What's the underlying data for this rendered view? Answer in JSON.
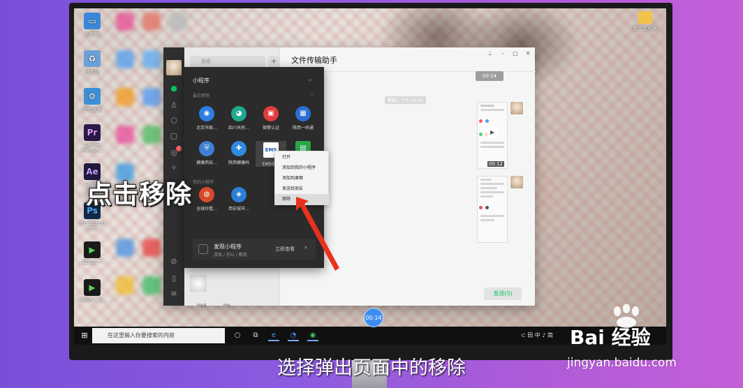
{
  "overlay": {
    "title": "点击移除",
    "subtitle": "选择弹出页面中的移除",
    "progress_time": "00:14"
  },
  "desktop": {
    "icons": [
      {
        "label": "此电脑",
        "icon": "computer-icon",
        "color": "#3b86d8"
      },
      {
        "label": "回收站",
        "icon": "recycle-bin-icon",
        "color": "#6aa0d8"
      },
      {
        "label": "控制面板",
        "icon": "control-panel-icon",
        "color": "#3c8fd6"
      },
      {
        "label": "Adobe Premie...",
        "icon": "premiere-icon",
        "color": "#2a1a4a"
      },
      {
        "label": "Adobe After Effects",
        "icon": "after-effects-icon",
        "color": "#1f1a3e"
      },
      {
        "label": "Photoshop CS6",
        "icon": "photoshop-icon",
        "color": "#0f2a4a"
      },
      {
        "label": "EDIUS 7",
        "icon": "edius-icon",
        "color": "#1a1a1a"
      },
      {
        "label": "EDIUS7_1...",
        "icon": "edius-icon",
        "color": "#1a1a1a"
      }
    ],
    "folder_label": "图片文件夹"
  },
  "wechat": {
    "window_title": "文件传输助手",
    "search_placeholder": "搜索",
    "plus": "+",
    "timestamp": "星期二 下午 02:43",
    "video_time_top": "00:14",
    "video_time_mid": "00:12",
    "send_label": "发送(S)",
    "contacts": [
      {
        "label": "mp4"
      },
      {
        "label": "mp"
      }
    ],
    "sidebar_badge": "7",
    "window_controls": {
      "pin": "⊥",
      "minimize": "–",
      "maximize": "□",
      "close": "✕"
    }
  },
  "mini_program": {
    "title": "小程序",
    "recent_label": "最近使用",
    "my_label": "我的小程序",
    "apps_row1": [
      {
        "label": "北京市政...",
        "color": "#2d7fe0",
        "icon": "app-icon"
      },
      {
        "label": "四川天府...",
        "color": "#1fa98f",
        "icon": "panda-icon"
      },
      {
        "label": "微警认证",
        "color": "#e03c3c",
        "icon": "badge-icon"
      },
      {
        "label": "陕西一码通",
        "color": "#2b6fd6",
        "icon": "qr-icon"
      }
    ],
    "apps_row2": [
      {
        "label": "健康西安...",
        "color": "#3f7fd6",
        "icon": "shield-icon"
      },
      {
        "label": "陕西健康码",
        "color": "#2f8ae0",
        "icon": "cross-icon"
      },
      {
        "label": "EMS中...",
        "color": "#1a5fb0",
        "icon": "ems-icon"
      },
      {
        "label": "",
        "color": "#2aa84a",
        "icon": "doc-icon"
      }
    ],
    "apps_row3": [
      {
        "label": "全球好看...",
        "color": "#d84a2a",
        "icon": "globe-icon"
      },
      {
        "label": "西安城市...",
        "color": "#2b7fd6",
        "icon": "city-icon"
      }
    ],
    "discover": {
      "title": "发现小程序",
      "subtitle": "游戏 / 办公 / 教育",
      "action": "立即查看"
    }
  },
  "context_menu": {
    "items": [
      {
        "label": "打开"
      },
      {
        "label": "添加到我的小程序"
      },
      {
        "label": "添加到桌面"
      },
      {
        "label": "发送给朋友"
      },
      {
        "label": "移除"
      }
    ]
  },
  "taskbar": {
    "search_placeholder": "在这里输入你要搜索的内容",
    "tray_text": "⊂ 田 中 ♪ 简"
  },
  "watermark": {
    "logo": "Bai 经验",
    "url": "jingyan.baidu.com"
  },
  "colors": {
    "background_start": "#7a4fd8",
    "background_end": "#c45fd8",
    "wechat_green": "#07c160",
    "arrow_red": "#e8321e"
  }
}
